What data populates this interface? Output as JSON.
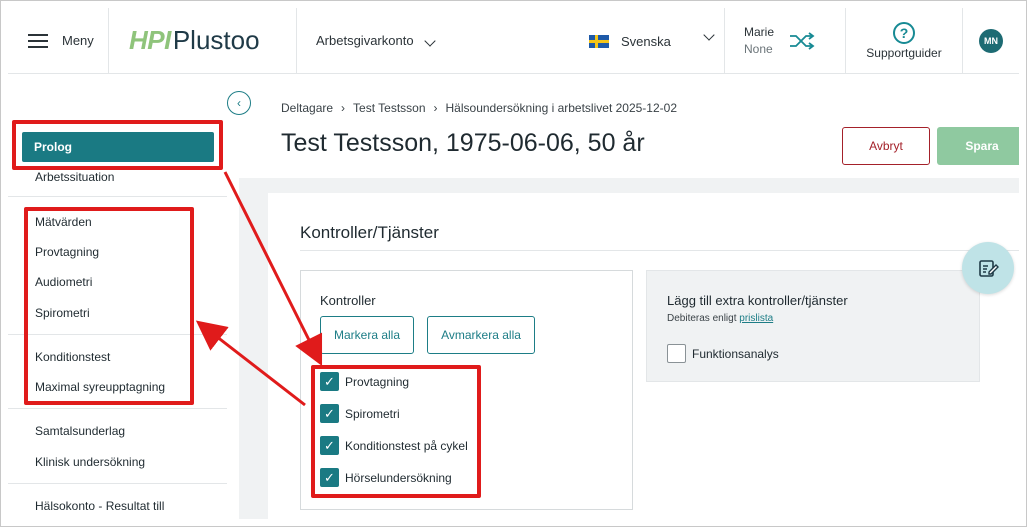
{
  "header": {
    "menu_label": "Meny",
    "logo_part1": "HPI",
    "logo_part2": "Plustoo",
    "account_label": "Arbetsgivarkonto",
    "language": "Svenska",
    "user_name": "Marie",
    "user_org": "None",
    "support_label": "Supportguider",
    "avatar_initials": "MN"
  },
  "sidebar": {
    "active": "Prolog",
    "items": [
      "Arbetssituation",
      "Mätvärden",
      "Provtagning",
      "Audiometri",
      "Spirometri",
      "Konditionstest",
      "Maximal syreupptagning",
      "Samtalsunderlag",
      "Klinisk undersökning",
      "Hälsokonto - Resultat till"
    ]
  },
  "breadcrumb": [
    "Deltagare",
    "Test Testsson",
    "Hälsoundersökning i arbetslivet 2025-12-02"
  ],
  "page_title": "Test Testsson, 1975-06-06, 50 år",
  "actions": {
    "cancel": "Avbryt",
    "save": "Spara"
  },
  "section": {
    "title": "Kontroller/Tjänster",
    "controls": {
      "title": "Kontroller",
      "select_all": "Markera alla",
      "deselect_all": "Avmarkera alla",
      "items": [
        {
          "label": "Provtagning",
          "checked": true
        },
        {
          "label": "Spirometri",
          "checked": true
        },
        {
          "label": "Konditionstest på cykel",
          "checked": true
        },
        {
          "label": "Hörselundersökning",
          "checked": true
        }
      ]
    },
    "extra": {
      "title": "Lägg till extra kontroller/tjänster",
      "subtitle": "Debiteras enligt",
      "link": "prislista",
      "option": "Funktionsanalys",
      "option_checked": false
    }
  },
  "colors": {
    "teal": "#1a7a83",
    "annotation": "#e01b1b",
    "cancel": "#a4212a",
    "save": "#8fc9a0"
  }
}
